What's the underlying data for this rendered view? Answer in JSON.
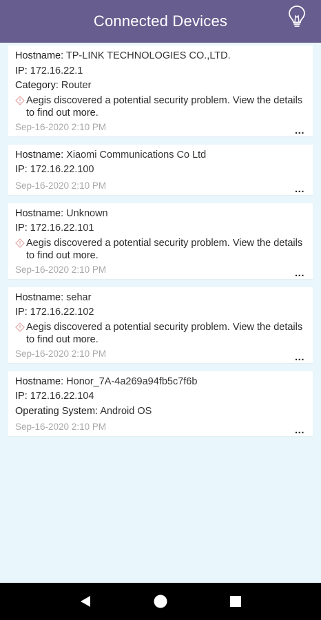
{
  "header": {
    "title": "Connected Devices",
    "icon": "lightbulb-icon",
    "bg_color": "#675d8f"
  },
  "devices": [
    {
      "hostname_label": "Hostname:",
      "hostname": "TP-LINK TECHNOLOGIES CO.,LTD.",
      "ip_label": "IP:",
      "ip": "172.16.22.1",
      "extra_label": "Category:",
      "extra_value": "Router",
      "alert": "Aegis discovered a potential security problem. View the details to find out more.",
      "timestamp": "Sep-16-2020 2:10 PM",
      "more": "..."
    },
    {
      "hostname_label": "Hostname:",
      "hostname": "Xiaomi Communications Co Ltd",
      "ip_label": "IP:",
      "ip": "172.16.22.100",
      "timestamp": "Sep-16-2020 2:10 PM",
      "more": "..."
    },
    {
      "hostname_label": "Hostname:",
      "hostname": "Unknown",
      "ip_label": "IP:",
      "ip": "172.16.22.101",
      "alert": "Aegis discovered a potential security problem. View the details to find out more.",
      "timestamp": "Sep-16-2020 2:10 PM",
      "more": "..."
    },
    {
      "hostname_label": "Hostname:",
      "hostname": "sehar",
      "ip_label": "IP:",
      "ip": "172.16.22.102",
      "alert": "Aegis discovered a potential security problem. View the details to find out more.",
      "timestamp": "Sep-16-2020 2:10 PM",
      "more": "..."
    },
    {
      "hostname_label": "Hostname:",
      "hostname": "Honor_7A-4a269a94fb5c7f6b",
      "ip_label": "IP:",
      "ip": "172.16.22.104",
      "extra_label": "Operating System:",
      "extra_value": "Android OS",
      "timestamp": "Sep-16-2020 2:10 PM",
      "more": "..."
    }
  ],
  "navbar": {
    "back_icon": "back-triangle-icon",
    "home_icon": "home-circle-icon",
    "recents_icon": "recents-square-icon"
  },
  "colors": {
    "background": "#e9f6fb",
    "card": "#ffffff",
    "timestamp": "#a9a9a9",
    "alert_icon": "#e0a7a7"
  }
}
